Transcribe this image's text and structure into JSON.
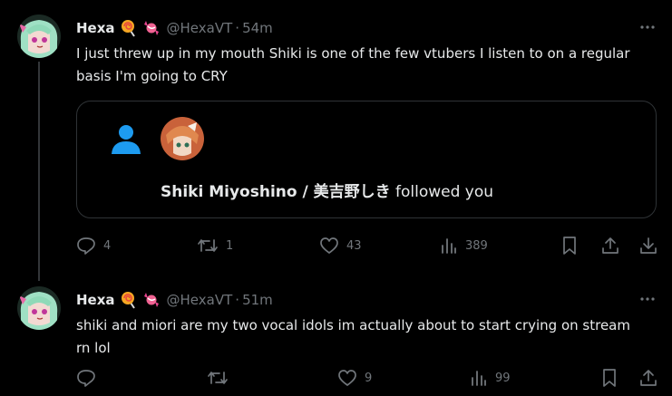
{
  "colors": {
    "background": "#000000",
    "text": "#e7e9ea",
    "muted": "#71767b",
    "follow_icon": "#1d9bf0",
    "border": "#2f3336"
  },
  "tweets": [
    {
      "author": "Hexa",
      "handle": "@HexaVT",
      "dot": "·",
      "time": "54m",
      "emojis": [
        "lollipop-emoji",
        "candy-emoji"
      ],
      "text": "I just threw up in my mouth Shiki is one of the few vtubers I listen to on a regular basis I'm going to CRY",
      "card": {
        "icon": "person-icon",
        "name": "Shiki Miyoshino / 美吉野しき",
        "action": " followed you"
      },
      "stats": {
        "replies": "4",
        "reposts": "1",
        "likes": "43",
        "views": "389"
      }
    },
    {
      "author": "Hexa",
      "handle": "@HexaVT",
      "dot": "·",
      "time": "51m",
      "emojis": [
        "lollipop-emoji",
        "candy-emoji"
      ],
      "text": "shiki and miori are my two vocal idols im actually about to start crying on stream rn lol",
      "stats": {
        "replies": "",
        "reposts": "",
        "likes": "9",
        "views": "99"
      }
    }
  ]
}
